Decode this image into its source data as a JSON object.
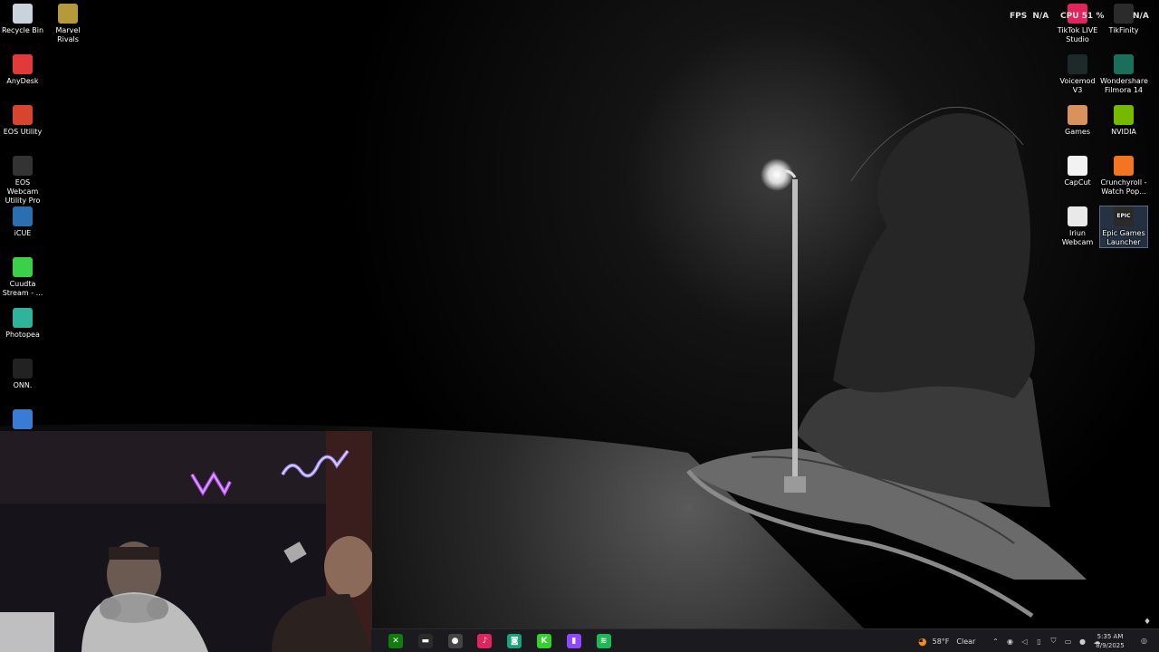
{
  "overlay": {
    "fps_label": "FPS",
    "fps_value": "N/A",
    "cpu_label": "CPU",
    "cpu_value": "51 %",
    "gpu_value": "N/A"
  },
  "desktop_left": [
    {
      "label": "Recycle Bin",
      "icon": "recycle-bin-icon",
      "color": "#c9d3de"
    },
    {
      "label": "Marvel Rivals",
      "icon": "marvel-rivals-icon",
      "color": "#b59a3c"
    },
    {
      "label": "AnyDesk",
      "icon": "anydesk-icon",
      "color": "#e23a3a"
    },
    {
      "label": "EOS Utility",
      "icon": "eos-utility-icon",
      "color": "#d8442e"
    },
    {
      "label": "EOS Webcam Utility Pro",
      "icon": "eos-webcam-icon",
      "color": "#333333"
    },
    {
      "label": "iCUE",
      "icon": "icue-icon",
      "color": "#2a6fb0"
    },
    {
      "label": "Cuudta Stream - ...",
      "icon": "stream-k-icon",
      "color": "#3ad04a"
    },
    {
      "label": "Photopea",
      "icon": "photopea-icon",
      "color": "#2fb39a"
    },
    {
      "label": "ONN.",
      "icon": "onn-icon",
      "color": "#222222"
    },
    {
      "label": "",
      "icon": "app-globe-icon",
      "color": "#3a7bd5"
    }
  ],
  "desktop_right": [
    {
      "label": "TikTok LIVE Studio",
      "icon": "tiktok-live-icon",
      "color": "#e0245e"
    },
    {
      "label": "TikFinity",
      "icon": "tikfinity-icon",
      "color": "#2b2b2b"
    },
    {
      "label": "Voicemod V3",
      "icon": "voicemod-icon",
      "color": "#1e2a2a"
    },
    {
      "label": "Wondershare Filmora 14",
      "icon": "filmora-icon",
      "color": "#1b6f5a"
    },
    {
      "label": "Games",
      "icon": "games-folder-icon",
      "color": "#d9925c"
    },
    {
      "label": "NVIDIA",
      "icon": "nvidia-icon",
      "color": "#76b900"
    },
    {
      "label": "CapCut",
      "icon": "capcut-icon",
      "color": "#f2f2f2"
    },
    {
      "label": "Crunchyroll - Watch Pop...",
      "icon": "crunchyroll-icon",
      "color": "#f47521"
    },
    {
      "label": "Iriun Webcam",
      "icon": "iriun-webcam-icon",
      "color": "#e9e9e9"
    },
    {
      "label": "Epic Games Launcher",
      "icon": "epic-games-icon",
      "color": "#2a2a2a"
    }
  ],
  "epic_text": "EPIC",
  "taskbar": {
    "apps": [
      {
        "icon": "xbox-icon",
        "color": "#107c10",
        "glyph": "✕"
      },
      {
        "icon": "terminal-app-icon",
        "color": "#2b2b2b",
        "glyph": "▬"
      },
      {
        "icon": "chrome-like-icon",
        "color": "#444444",
        "glyph": "●"
      },
      {
        "icon": "tiktok-taskbar-icon",
        "color": "#e0245e",
        "glyph": "♪"
      },
      {
        "icon": "discord-like-icon",
        "color": "#1aa37a",
        "glyph": "◙"
      },
      {
        "icon": "kick-icon",
        "color": "#33d12c",
        "glyph": "K"
      },
      {
        "icon": "twitch-icon",
        "color": "#9146ff",
        "glyph": "▮"
      },
      {
        "icon": "spotify-icon",
        "color": "#1db954",
        "glyph": "≋"
      }
    ],
    "weather_temp": "58°F",
    "weather_desc": "Clear",
    "time": "5:35 AM",
    "date": "8/9/2025"
  }
}
